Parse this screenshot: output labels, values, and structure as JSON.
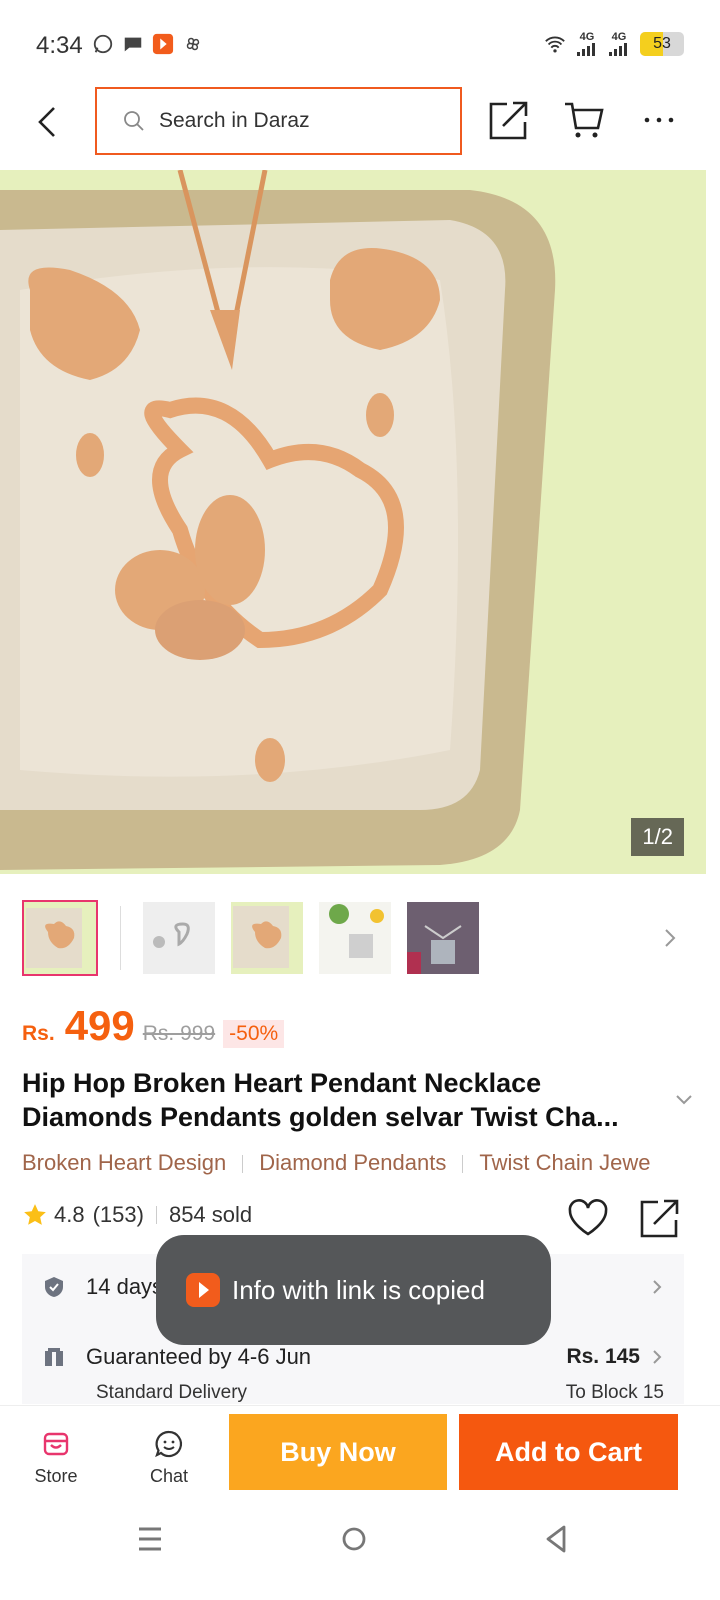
{
  "status_bar": {
    "time": "4:34",
    "network_1": "4G",
    "network_2": "4G",
    "battery": "53",
    "battery_level": 0.53
  },
  "header": {
    "search_placeholder": "Search in Daraz"
  },
  "gallery": {
    "counter": "1/2"
  },
  "price": {
    "currency": "Rs.",
    "current": "499",
    "original": "Rs. 999",
    "discount": "-50%"
  },
  "product": {
    "title": "Hip Hop Broken Heart Pendant Necklace Diamonds Pendants golden selvar Twist Cha..."
  },
  "tags": [
    "Broken Heart Design",
    "Diamond Pendants",
    "Twist Chain Jewe"
  ],
  "rating": {
    "score": "4.8",
    "count": "(153)",
    "sold": "854 sold"
  },
  "info": {
    "return_text": "14 days",
    "delivery_text": "Guaranteed by 4-6 Jun",
    "delivery_sub": "Standard Delivery",
    "delivery_price": "Rs. 145",
    "delivery_location": "To Block 15"
  },
  "toast": {
    "text": "Info with link is copied"
  },
  "bottom_bar": {
    "store": "Store",
    "chat": "Chat",
    "buy_now": "Buy Now",
    "add_to_cart": "Add to Cart"
  },
  "colors": {
    "accent": "#f5600f",
    "buy_now": "#fba61f",
    "add_to_cart": "#f5580f",
    "tag_text": "#a0654a"
  }
}
